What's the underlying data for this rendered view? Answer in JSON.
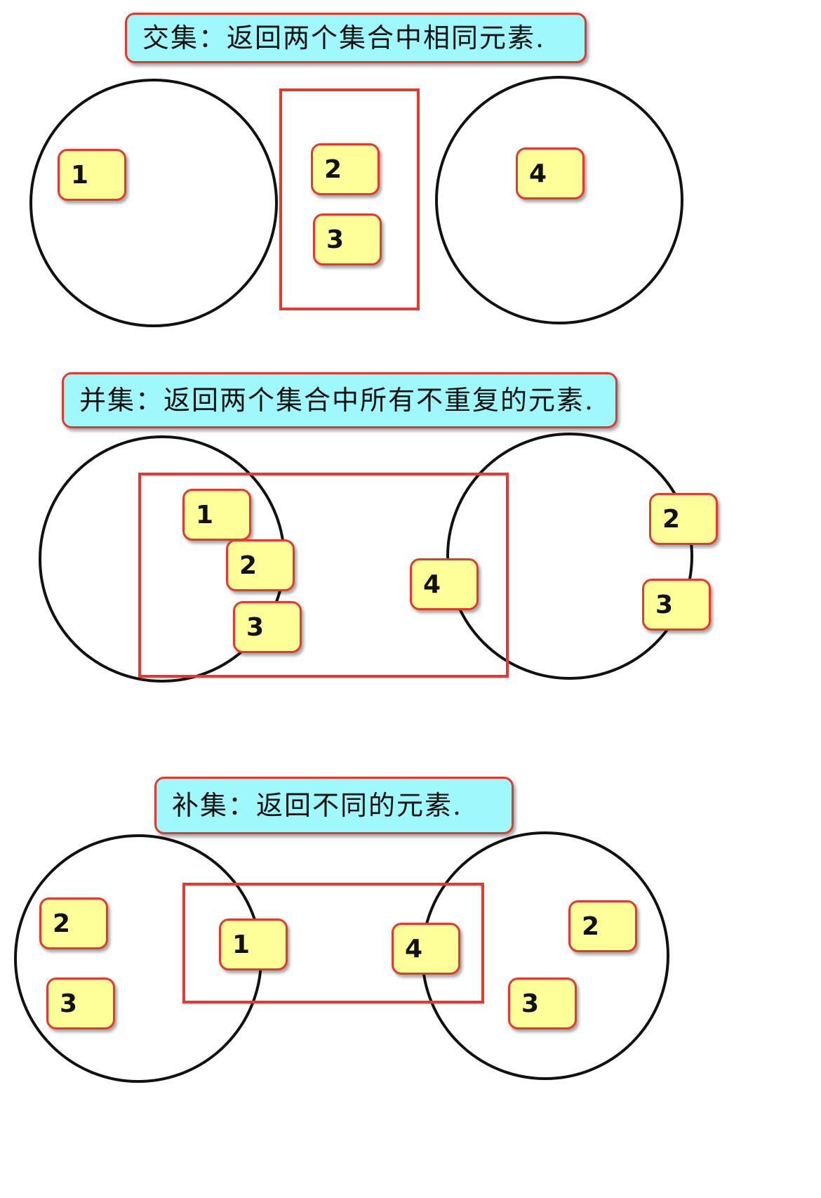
{
  "intersection": {
    "title": "交集：返回两个集合中相同元素.",
    "left_set": [
      "1"
    ],
    "selected": [
      "2",
      "3"
    ],
    "right_set": [
      "4"
    ]
  },
  "union": {
    "title": "并集：返回两个集合中所有不重复的元素.",
    "selected": [
      "1",
      "2",
      "3",
      "4"
    ],
    "right_set": [
      "2",
      "3"
    ]
  },
  "complement": {
    "title": "补集：返回不同的元素.",
    "left_set": [
      "2",
      "3"
    ],
    "selected": [
      "1",
      "4"
    ],
    "right_set": [
      "2",
      "3"
    ]
  },
  "colors": {
    "title_fill": "#9ff8fb",
    "tile_fill": "#ffff99",
    "border_red": "#e23a2e",
    "circle_stroke": "#111111"
  }
}
